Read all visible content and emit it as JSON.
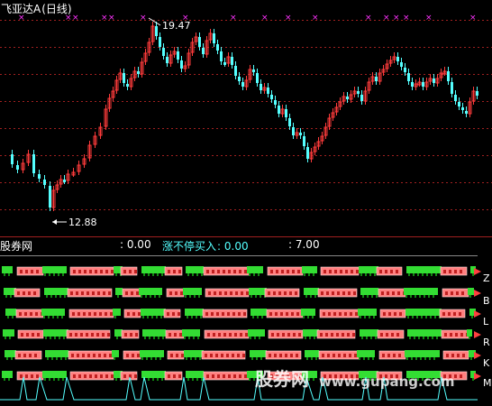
{
  "chart": {
    "title": "飞亚达A",
    "period": "(日线)",
    "high_label": "19.47",
    "low_label": "12.88",
    "title_color": "#ffffff",
    "up_color": "#ff3b3b",
    "down_color": "#54ffff",
    "signal_color": "#ff33ff",
    "grid_color": "#a02020"
  },
  "indicator": {
    "name": "股券网",
    "items": [
      {
        "label": "",
        "value": ": 0.00"
      },
      {
        "label": "涨不停买入",
        "value": ": 0.00"
      },
      {
        "label": "",
        "value": ": 7.00"
      }
    ],
    "row_letters": [
      "Z",
      "B",
      "L",
      "R",
      "K",
      "M"
    ],
    "block_up_color": "#ff8080",
    "block_down_color": "#33dd33",
    "line_color": "#54ffff"
  },
  "watermark": {
    "text": "股券网",
    "url": "www.gupang.com"
  }
}
